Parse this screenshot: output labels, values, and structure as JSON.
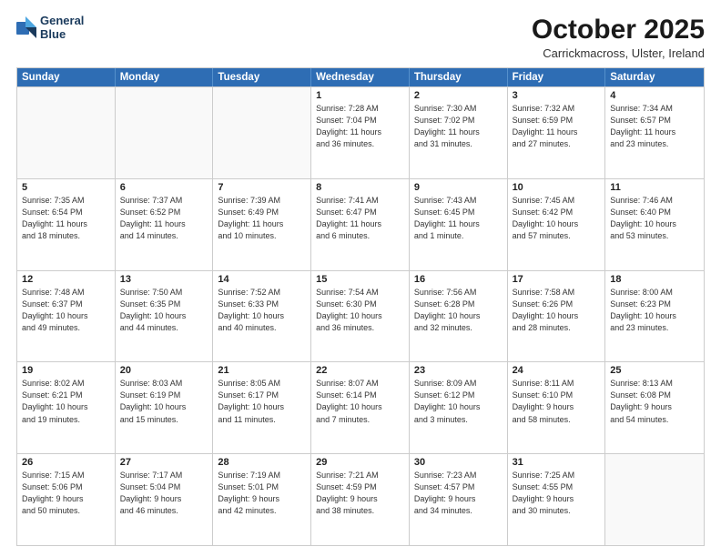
{
  "logo": {
    "line1": "General",
    "line2": "Blue"
  },
  "title": "October 2025",
  "subtitle": "Carrickmacross, Ulster, Ireland",
  "header_days": [
    "Sunday",
    "Monday",
    "Tuesday",
    "Wednesday",
    "Thursday",
    "Friday",
    "Saturday"
  ],
  "weeks": [
    [
      {
        "date": "",
        "info": ""
      },
      {
        "date": "",
        "info": ""
      },
      {
        "date": "",
        "info": ""
      },
      {
        "date": "1",
        "info": "Sunrise: 7:28 AM\nSunset: 7:04 PM\nDaylight: 11 hours\nand 36 minutes."
      },
      {
        "date": "2",
        "info": "Sunrise: 7:30 AM\nSunset: 7:02 PM\nDaylight: 11 hours\nand 31 minutes."
      },
      {
        "date": "3",
        "info": "Sunrise: 7:32 AM\nSunset: 6:59 PM\nDaylight: 11 hours\nand 27 minutes."
      },
      {
        "date": "4",
        "info": "Sunrise: 7:34 AM\nSunset: 6:57 PM\nDaylight: 11 hours\nand 23 minutes."
      }
    ],
    [
      {
        "date": "5",
        "info": "Sunrise: 7:35 AM\nSunset: 6:54 PM\nDaylight: 11 hours\nand 18 minutes."
      },
      {
        "date": "6",
        "info": "Sunrise: 7:37 AM\nSunset: 6:52 PM\nDaylight: 11 hours\nand 14 minutes."
      },
      {
        "date": "7",
        "info": "Sunrise: 7:39 AM\nSunset: 6:49 PM\nDaylight: 11 hours\nand 10 minutes."
      },
      {
        "date": "8",
        "info": "Sunrise: 7:41 AM\nSunset: 6:47 PM\nDaylight: 11 hours\nand 6 minutes."
      },
      {
        "date": "9",
        "info": "Sunrise: 7:43 AM\nSunset: 6:45 PM\nDaylight: 11 hours\nand 1 minute."
      },
      {
        "date": "10",
        "info": "Sunrise: 7:45 AM\nSunset: 6:42 PM\nDaylight: 10 hours\nand 57 minutes."
      },
      {
        "date": "11",
        "info": "Sunrise: 7:46 AM\nSunset: 6:40 PM\nDaylight: 10 hours\nand 53 minutes."
      }
    ],
    [
      {
        "date": "12",
        "info": "Sunrise: 7:48 AM\nSunset: 6:37 PM\nDaylight: 10 hours\nand 49 minutes."
      },
      {
        "date": "13",
        "info": "Sunrise: 7:50 AM\nSunset: 6:35 PM\nDaylight: 10 hours\nand 44 minutes."
      },
      {
        "date": "14",
        "info": "Sunrise: 7:52 AM\nSunset: 6:33 PM\nDaylight: 10 hours\nand 40 minutes."
      },
      {
        "date": "15",
        "info": "Sunrise: 7:54 AM\nSunset: 6:30 PM\nDaylight: 10 hours\nand 36 minutes."
      },
      {
        "date": "16",
        "info": "Sunrise: 7:56 AM\nSunset: 6:28 PM\nDaylight: 10 hours\nand 32 minutes."
      },
      {
        "date": "17",
        "info": "Sunrise: 7:58 AM\nSunset: 6:26 PM\nDaylight: 10 hours\nand 28 minutes."
      },
      {
        "date": "18",
        "info": "Sunrise: 8:00 AM\nSunset: 6:23 PM\nDaylight: 10 hours\nand 23 minutes."
      }
    ],
    [
      {
        "date": "19",
        "info": "Sunrise: 8:02 AM\nSunset: 6:21 PM\nDaylight: 10 hours\nand 19 minutes."
      },
      {
        "date": "20",
        "info": "Sunrise: 8:03 AM\nSunset: 6:19 PM\nDaylight: 10 hours\nand 15 minutes."
      },
      {
        "date": "21",
        "info": "Sunrise: 8:05 AM\nSunset: 6:17 PM\nDaylight: 10 hours\nand 11 minutes."
      },
      {
        "date": "22",
        "info": "Sunrise: 8:07 AM\nSunset: 6:14 PM\nDaylight: 10 hours\nand 7 minutes."
      },
      {
        "date": "23",
        "info": "Sunrise: 8:09 AM\nSunset: 6:12 PM\nDaylight: 10 hours\nand 3 minutes."
      },
      {
        "date": "24",
        "info": "Sunrise: 8:11 AM\nSunset: 6:10 PM\nDaylight: 9 hours\nand 58 minutes."
      },
      {
        "date": "25",
        "info": "Sunrise: 8:13 AM\nSunset: 6:08 PM\nDaylight: 9 hours\nand 54 minutes."
      }
    ],
    [
      {
        "date": "26",
        "info": "Sunrise: 7:15 AM\nSunset: 5:06 PM\nDaylight: 9 hours\nand 50 minutes."
      },
      {
        "date": "27",
        "info": "Sunrise: 7:17 AM\nSunset: 5:04 PM\nDaylight: 9 hours\nand 46 minutes."
      },
      {
        "date": "28",
        "info": "Sunrise: 7:19 AM\nSunset: 5:01 PM\nDaylight: 9 hours\nand 42 minutes."
      },
      {
        "date": "29",
        "info": "Sunrise: 7:21 AM\nSunset: 4:59 PM\nDaylight: 9 hours\nand 38 minutes."
      },
      {
        "date": "30",
        "info": "Sunrise: 7:23 AM\nSunset: 4:57 PM\nDaylight: 9 hours\nand 34 minutes."
      },
      {
        "date": "31",
        "info": "Sunrise: 7:25 AM\nSunset: 4:55 PM\nDaylight: 9 hours\nand 30 minutes."
      },
      {
        "date": "",
        "info": ""
      }
    ]
  ]
}
